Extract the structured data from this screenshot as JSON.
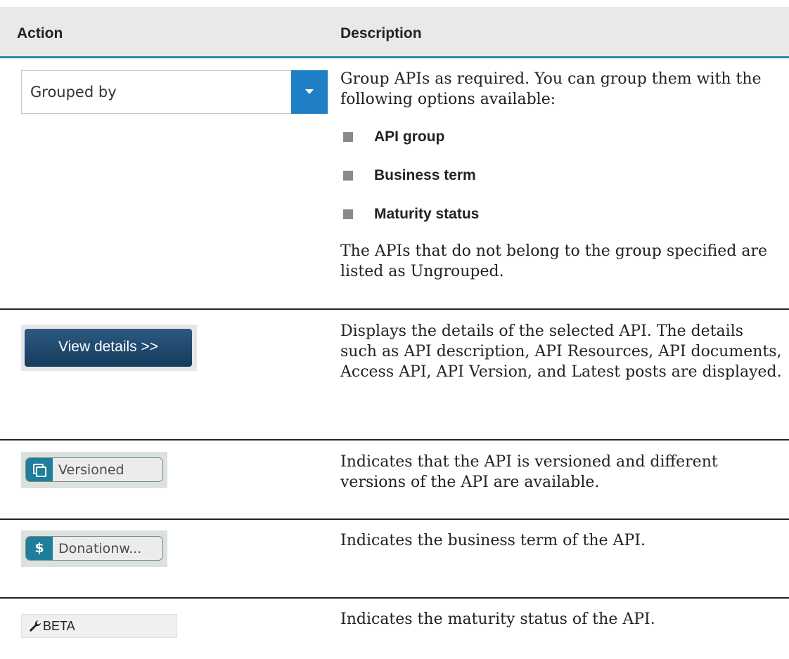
{
  "table": {
    "headers": {
      "action": "Action",
      "description": "Description"
    },
    "rows": [
      {
        "action": {
          "type": "dropdown",
          "label": "Grouped by"
        },
        "description": "Group APIs as required. You can group them with the following options available:",
        "bullets": [
          "API group",
          "Business term",
          "Maturity status"
        ],
        "note": "The APIs that do not belong to the group specified are listed as Ungrouped."
      },
      {
        "action": {
          "type": "button",
          "label": "View details >>"
        },
        "description": "Displays the details of the selected API. The details such as API description, API Resources, API documents, Access API, API Version, and Latest posts are displayed."
      },
      {
        "action": {
          "type": "tag",
          "label": "Versioned",
          "icon": "copy-icon"
        },
        "description": "Indicates that the API is versioned and different versions of the API are available."
      },
      {
        "action": {
          "type": "tag",
          "label": "Donationw...",
          "icon": "dollar-icon",
          "icon_text": "$"
        },
        "description": "Indicates the business term of the API."
      },
      {
        "action": {
          "type": "badge",
          "label": "BETA",
          "icon": "wrench-icon"
        },
        "description": "Indicates the maturity status of the API."
      }
    ]
  },
  "colors": {
    "header_underline": "#2a8aa8",
    "dropdown_button": "#1f7fc6",
    "view_button": "#1f4a70",
    "tag_icon": "#1e7f9c"
  }
}
